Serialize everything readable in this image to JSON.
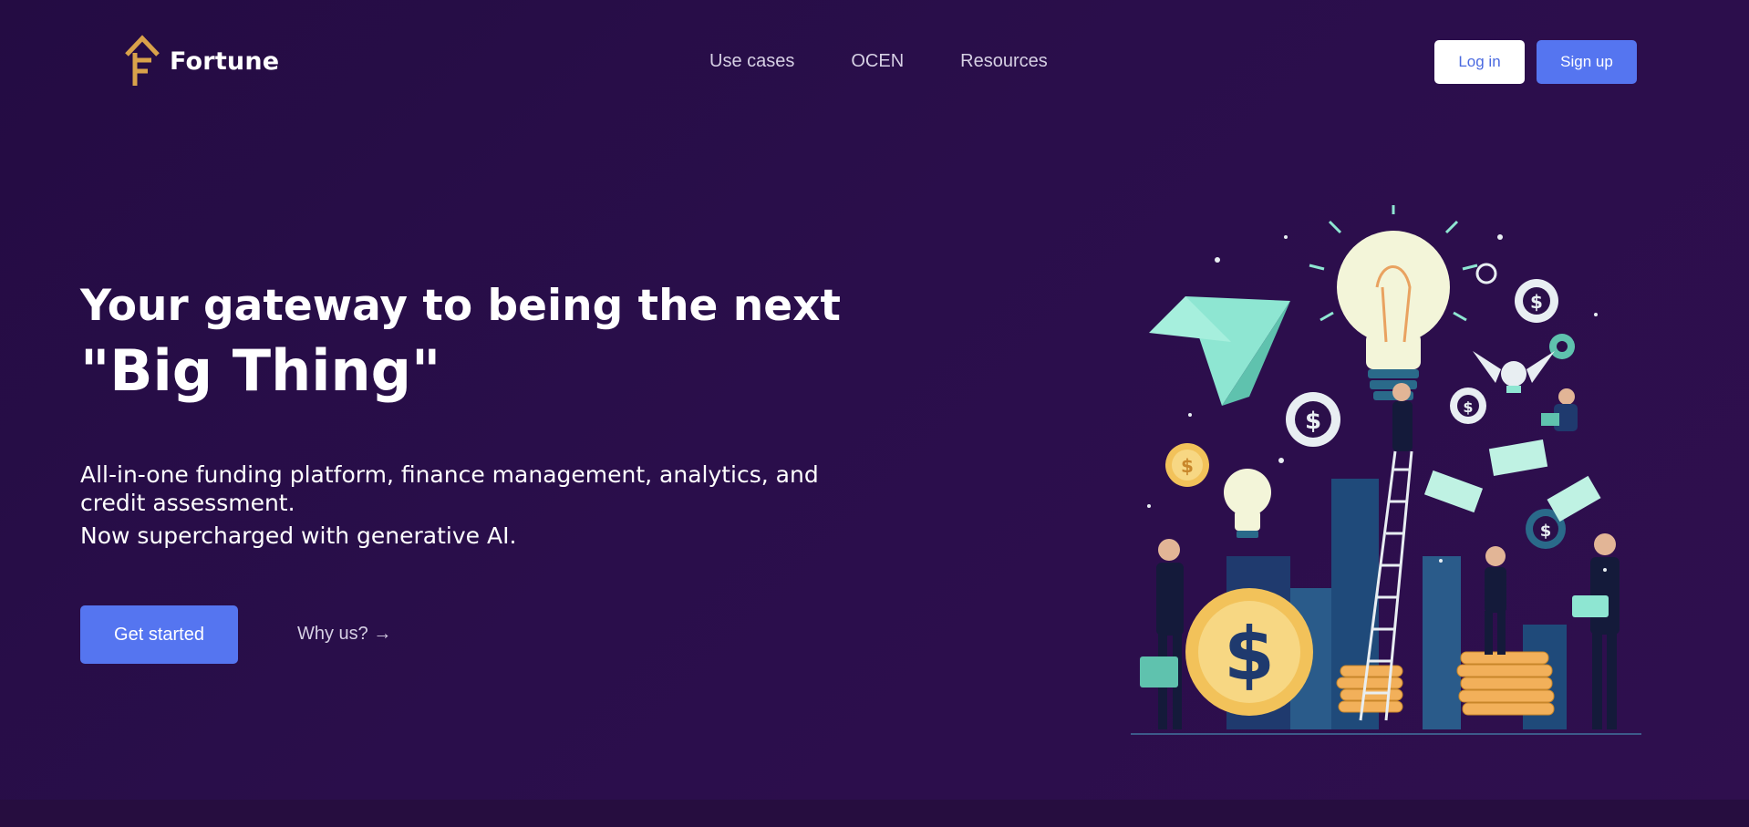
{
  "brand": {
    "name": "Fortune",
    "accent": "#d9a24a"
  },
  "nav": {
    "items": [
      {
        "label": "Use cases"
      },
      {
        "label": "OCEN"
      },
      {
        "label": "Resources"
      }
    ]
  },
  "auth": {
    "login_label": "Log in",
    "signup_label": "Sign up"
  },
  "hero": {
    "headline_line1": "Your gateway to being the next",
    "headline_line2": "\"Big Thing\"",
    "description": "All-in-one funding platform, finance management, analytics, and credit assessment.",
    "tagline": "Now supercharged with generative AI.",
    "cta_primary": "Get started",
    "cta_secondary": "Why us? →"
  },
  "illustration": {
    "coin_symbol": "$"
  },
  "colors": {
    "background": "#270d46",
    "primary_button": "#5575f0",
    "login_text": "#4b6ae0",
    "teal": "#8ee6d2",
    "gold": "#f2c25a",
    "navy": "#1f3a6e"
  }
}
